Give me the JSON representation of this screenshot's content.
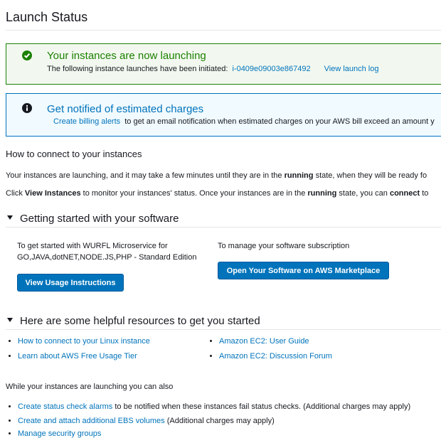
{
  "page": {
    "title": "Launch Status"
  },
  "success_alert": {
    "title": "Your instances are now launching",
    "body_prefix": "The following instance launches have been initiated:",
    "instance_id": "i-0409e09003e867492",
    "log_link": "View launch log",
    "icon": "check-circle-icon",
    "color": "#1d8102"
  },
  "info_alert": {
    "title": "Get notified of estimated charges",
    "link": "Create billing alerts",
    "body": "to get an email notification when estimated charges on your AWS bill exceed an amount y",
    "icon": "info-circle-icon",
    "color": "#0073bb"
  },
  "connect": {
    "heading": "How to connect to your instances",
    "line1": {
      "a": "Your instances are launching, and it may take a few minutes until they are in the",
      "b": "running",
      "c": "state, when they will be ready fo"
    },
    "line2": {
      "a": "Click",
      "b": "View Instances",
      "c": "to monitor your instances' status. Once your instances are in the",
      "d": "running",
      "e": "state, you can",
      "f": "connect",
      "g": "to"
    }
  },
  "software": {
    "heading": "Getting started with your software",
    "left_text_1": "To get started with WURFL Microservice for",
    "left_text_2": "GO,JAVA,dotNET,NODE.JS,PHP - Standard Edition",
    "left_button": "View Usage Instructions",
    "right_text": "To manage your software subscription",
    "right_button": "Open Your Software on AWS Marketplace"
  },
  "resources": {
    "heading": "Here are some helpful resources to get you started",
    "left": [
      "How to connect to your Linux instance",
      "Learn about AWS Free Usage Tier"
    ],
    "right": [
      "Amazon EC2: User Guide",
      "Amazon EC2: Discussion Forum"
    ]
  },
  "also": {
    "heading": "While your instances are launching you can also",
    "items": [
      {
        "link": "Create status check alarms",
        "text": "to be notified when these instances fail status checks. (Additional charges may apply)"
      },
      {
        "link": "Create and attach additional EBS volumes",
        "text": "(Additional charges may apply)"
      },
      {
        "link": "Manage security groups",
        "text": ""
      }
    ]
  }
}
